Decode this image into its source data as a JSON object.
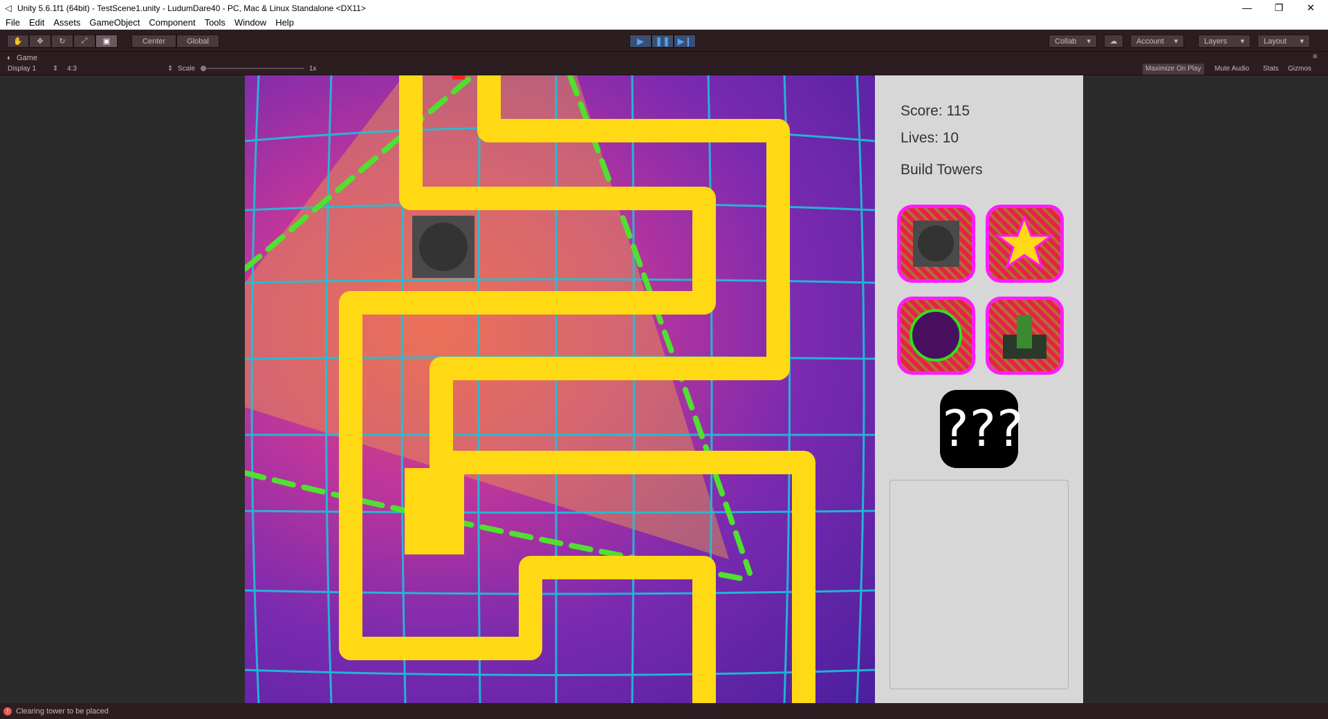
{
  "titlebar": {
    "title": "Unity 5.6.1f1 (64bit) - TestScene1.unity - LudumDare40 - PC, Mac & Linux Standalone <DX11>",
    "minimize": "—",
    "maximize": "❐",
    "close": "✕"
  },
  "menu": [
    "File",
    "Edit",
    "Assets",
    "GameObject",
    "Component",
    "Tools",
    "Window",
    "Help"
  ],
  "toolbar": {
    "pivot": "Center",
    "space": "Global",
    "collab": "Collab",
    "account": "Account",
    "layers": "Layers",
    "layout": "Layout",
    "accent": "#4aa3ff"
  },
  "gameview": {
    "tab": "Game",
    "display": "Display 1",
    "aspect": "4:3",
    "scale_label": "Scale",
    "scale_value": "1x",
    "maximize_on_play": "Maximize On Play",
    "mute_audio": "Mute Audio",
    "stats": "Stats",
    "gizmos": "Gizmos"
  },
  "hud": {
    "score": "Score: 115",
    "lives": "Lives: 10",
    "build_towers": "Build Towers",
    "mystery": "???",
    "towers": [
      "square-cannon",
      "star",
      "circle",
      "turret"
    ]
  },
  "status": {
    "message": "Clearing tower to be placed"
  },
  "colors": {
    "path": "#ffd700",
    "grid": "#19c4d8",
    "tower_border": "#ff1aff",
    "laser": "#50e030"
  }
}
